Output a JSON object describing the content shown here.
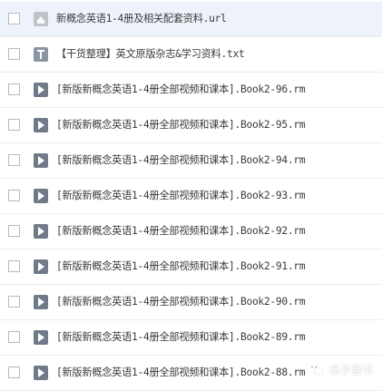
{
  "files": [
    {
      "name": "新概念英语1-4册及相关配套资料.url",
      "type": "url",
      "icon": "link-file-icon"
    },
    {
      "name": "【干货整理】英文原版杂志&学习资料.txt",
      "type": "txt",
      "icon": "text-file-icon"
    },
    {
      "name": "[新版新概念英语1-4册全部视频和课本].Book2-96.rm",
      "type": "rm",
      "icon": "video-file-icon"
    },
    {
      "name": "[新版新概念英语1-4册全部视频和课本].Book2-95.rm",
      "type": "rm",
      "icon": "video-file-icon"
    },
    {
      "name": "[新版新概念英语1-4册全部视频和课本].Book2-94.rm",
      "type": "rm",
      "icon": "video-file-icon"
    },
    {
      "name": "[新版新概念英语1-4册全部视频和课本].Book2-93.rm",
      "type": "rm",
      "icon": "video-file-icon"
    },
    {
      "name": "[新版新概念英语1-4册全部视频和课本].Book2-92.rm",
      "type": "rm",
      "icon": "video-file-icon"
    },
    {
      "name": "[新版新概念英语1-4册全部视频和课本].Book2-91.rm",
      "type": "rm",
      "icon": "video-file-icon"
    },
    {
      "name": "[新版新概念英语1-4册全部视频和课本].Book2-90.rm",
      "type": "rm",
      "icon": "video-file-icon"
    },
    {
      "name": "[新版新概念英语1-4册全部视频和课本].Book2-89.rm",
      "type": "rm",
      "icon": "video-file-icon"
    },
    {
      "name": "[新版新概念英语1-4册全部视频和课本].Book2-88.rm",
      "type": "rm",
      "icon": "video-file-icon"
    }
  ],
  "watermark": {
    "text": "亲子童书",
    "icon": "wechat-icon"
  }
}
